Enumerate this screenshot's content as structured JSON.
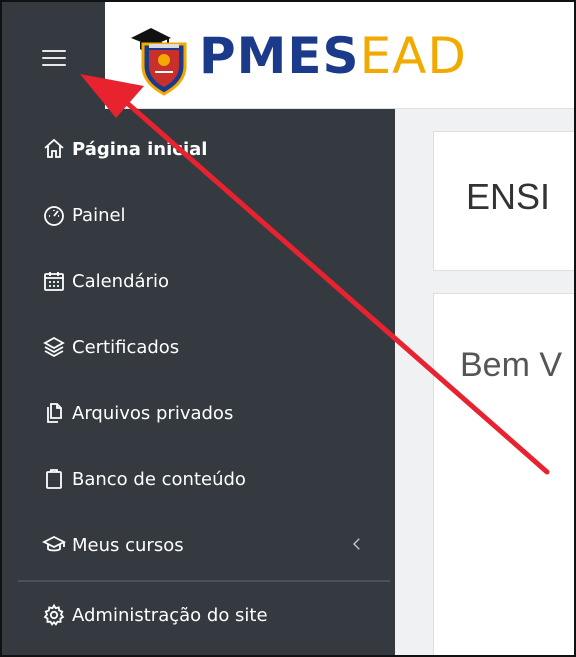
{
  "header": {
    "logo_main": "PMES",
    "logo_accent": "EAD"
  },
  "sidebar": {
    "menu_toggle": "menu",
    "items": [
      {
        "label": "Página inicial",
        "icon": "home-icon",
        "active": true
      },
      {
        "label": "Painel",
        "icon": "dashboard-gauge-icon"
      },
      {
        "label": "Calendário",
        "icon": "calendar-icon"
      },
      {
        "label": "Certificados",
        "icon": "layers-icon"
      },
      {
        "label": "Arquivos privados",
        "icon": "files-icon"
      },
      {
        "label": "Banco de conteúdo",
        "icon": "clipboard-icon"
      },
      {
        "label": "Meus cursos",
        "icon": "graduation-cap-icon",
        "expandable": true
      },
      {
        "label": "Administração do site",
        "icon": "gear-icon"
      }
    ]
  },
  "main": {
    "page_title": "ENSI",
    "welcome_text": "Bem V"
  },
  "colors": {
    "sidebar_bg": "#343a40",
    "logo_blue": "#1b3a8a",
    "logo_gold": "#f2a900",
    "annotation_arrow": "#e8222e"
  }
}
